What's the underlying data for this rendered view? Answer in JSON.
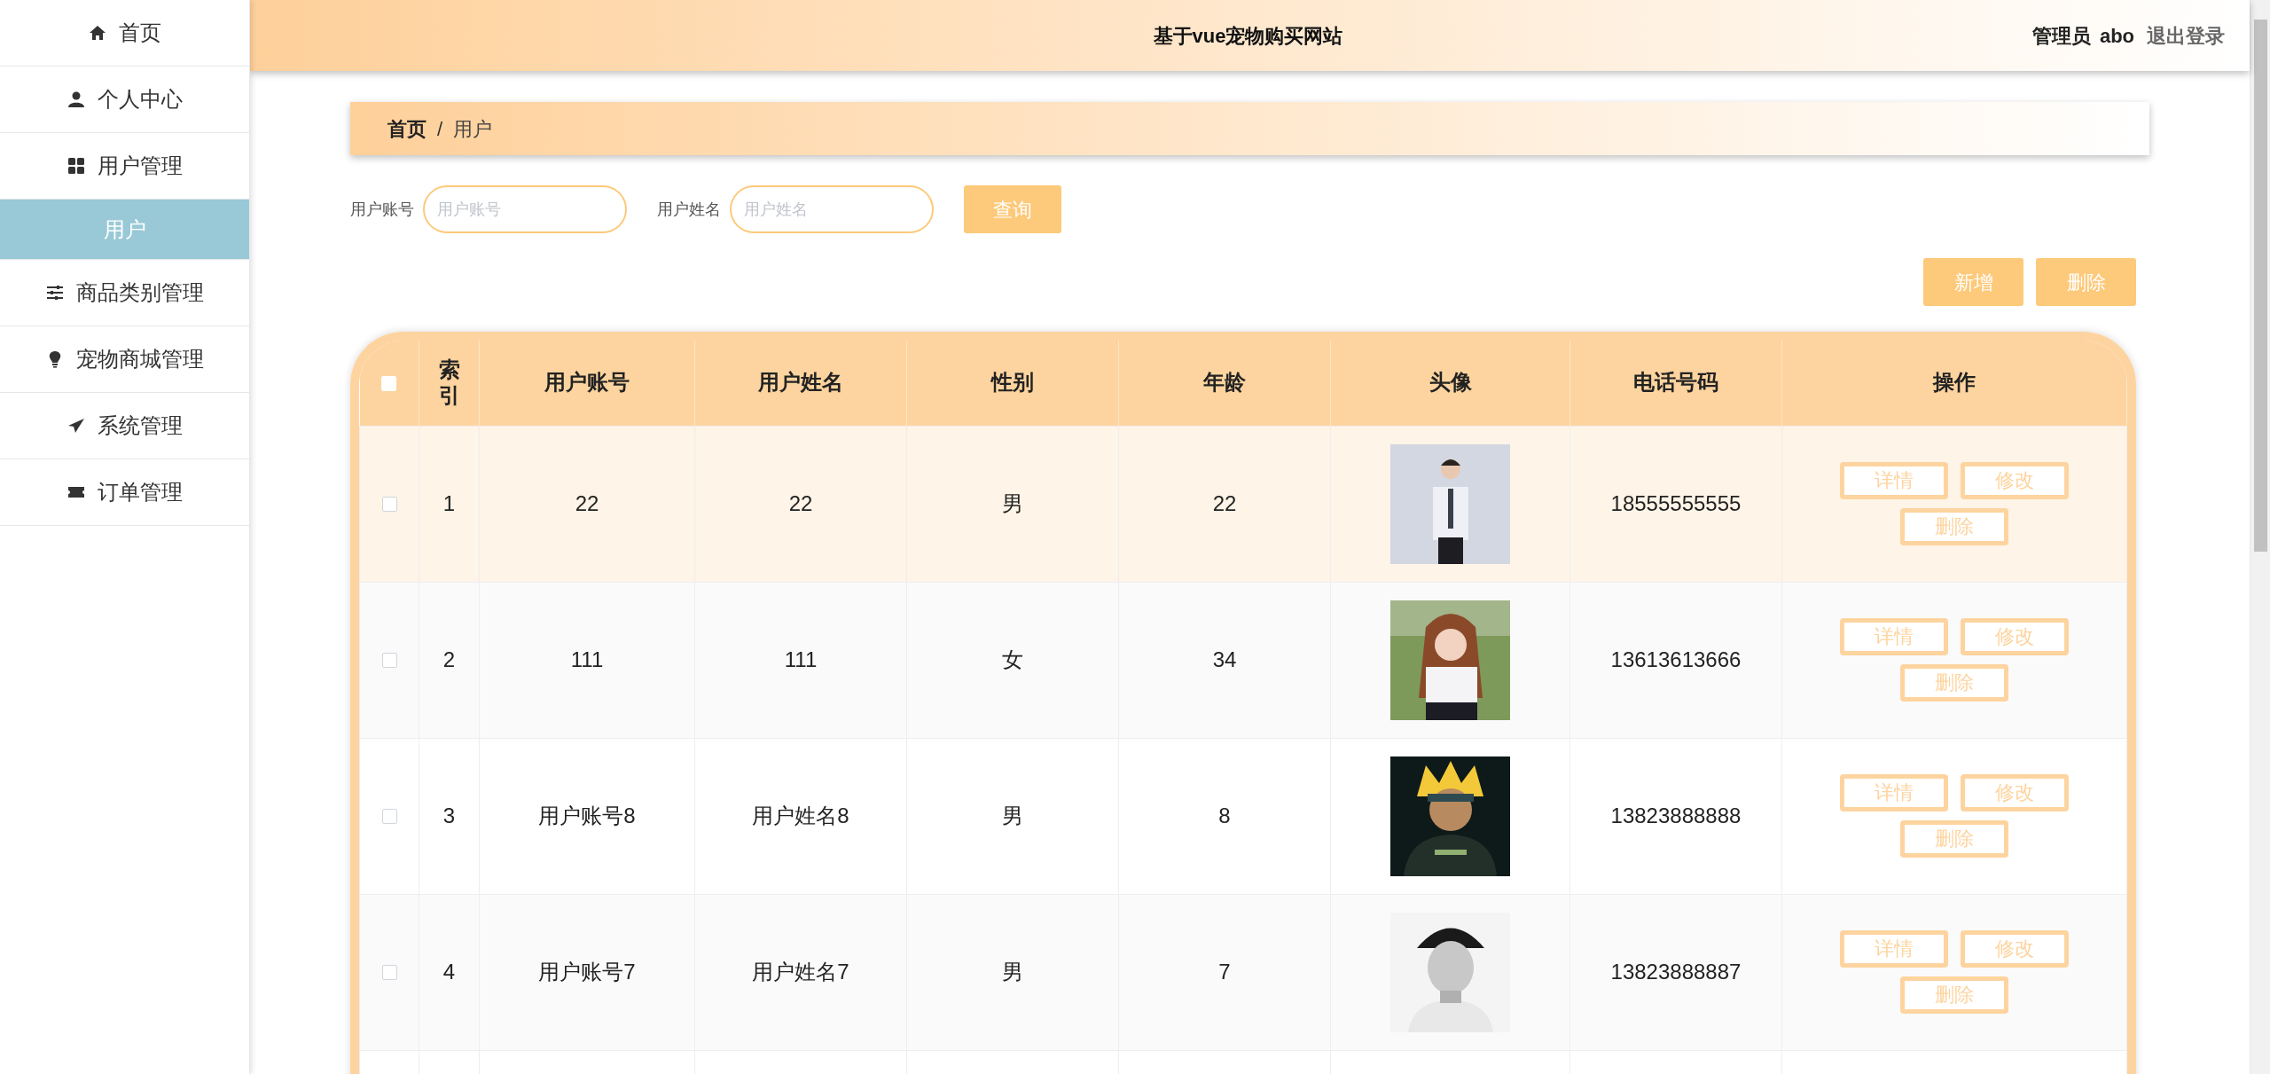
{
  "sidebar": {
    "items": [
      {
        "label": "首页",
        "selected": false
      },
      {
        "label": "个人中心",
        "selected": false
      },
      {
        "label": "用户管理",
        "selected": false
      },
      {
        "label": "用户",
        "selected": true
      },
      {
        "label": "商品类别管理",
        "selected": false
      },
      {
        "label": "宠物商城管理",
        "selected": false
      },
      {
        "label": "系统管理",
        "selected": false
      },
      {
        "label": "订单管理",
        "selected": false
      }
    ]
  },
  "header": {
    "title": "基于vue宠物购买网站",
    "role": "管理员",
    "user": "abo",
    "logout": "退出登录"
  },
  "breadcrumb": {
    "items": [
      "首页",
      "用户"
    ],
    "separator": "/"
  },
  "search": {
    "fields": [
      {
        "label": "用户账号",
        "placeholder": "用户账号"
      },
      {
        "label": "用户姓名",
        "placeholder": "用户姓名"
      }
    ],
    "button": "查询"
  },
  "actions": [
    "新增",
    "删除"
  ],
  "table": {
    "select_all": {
      "checked": false
    },
    "columns": [
      "索引",
      "用户账号",
      "用户姓名",
      "性别",
      "年龄",
      "头像",
      "电话号码",
      "操作"
    ],
    "rows": [
      {
        "checked": false,
        "selected": true,
        "cells": [
          "1",
          "22",
          "22",
          "男",
          "22"
        ],
        "avatar": {
          "kind": "picture"
        },
        "phone": "18555555555",
        "buttons": [
          "详情",
          "修改",
          "删除"
        ]
      },
      {
        "checked": false,
        "selected": false,
        "cells": [
          "2",
          "111",
          "111",
          "女",
          "34"
        ],
        "avatar": {
          "kind": "picture"
        },
        "phone": "13613613666",
        "buttons": [
          "详情",
          "修改",
          "删除"
        ]
      },
      {
        "checked": false,
        "selected": false,
        "cells": [
          "3",
          "用户账号8",
          "用户姓名8",
          "男",
          "8"
        ],
        "avatar": {
          "kind": "picture"
        },
        "phone": "13823888888",
        "buttons": [
          "详情",
          "修改",
          "删除"
        ]
      },
      {
        "checked": false,
        "selected": false,
        "cells": [
          "4",
          "用户账号7",
          "用户姓名7",
          "男",
          "7"
        ],
        "avatar": {
          "kind": "picture"
        },
        "phone": "13823888887",
        "buttons": [
          "详情",
          "修改",
          "删除"
        ]
      }
    ]
  }
}
